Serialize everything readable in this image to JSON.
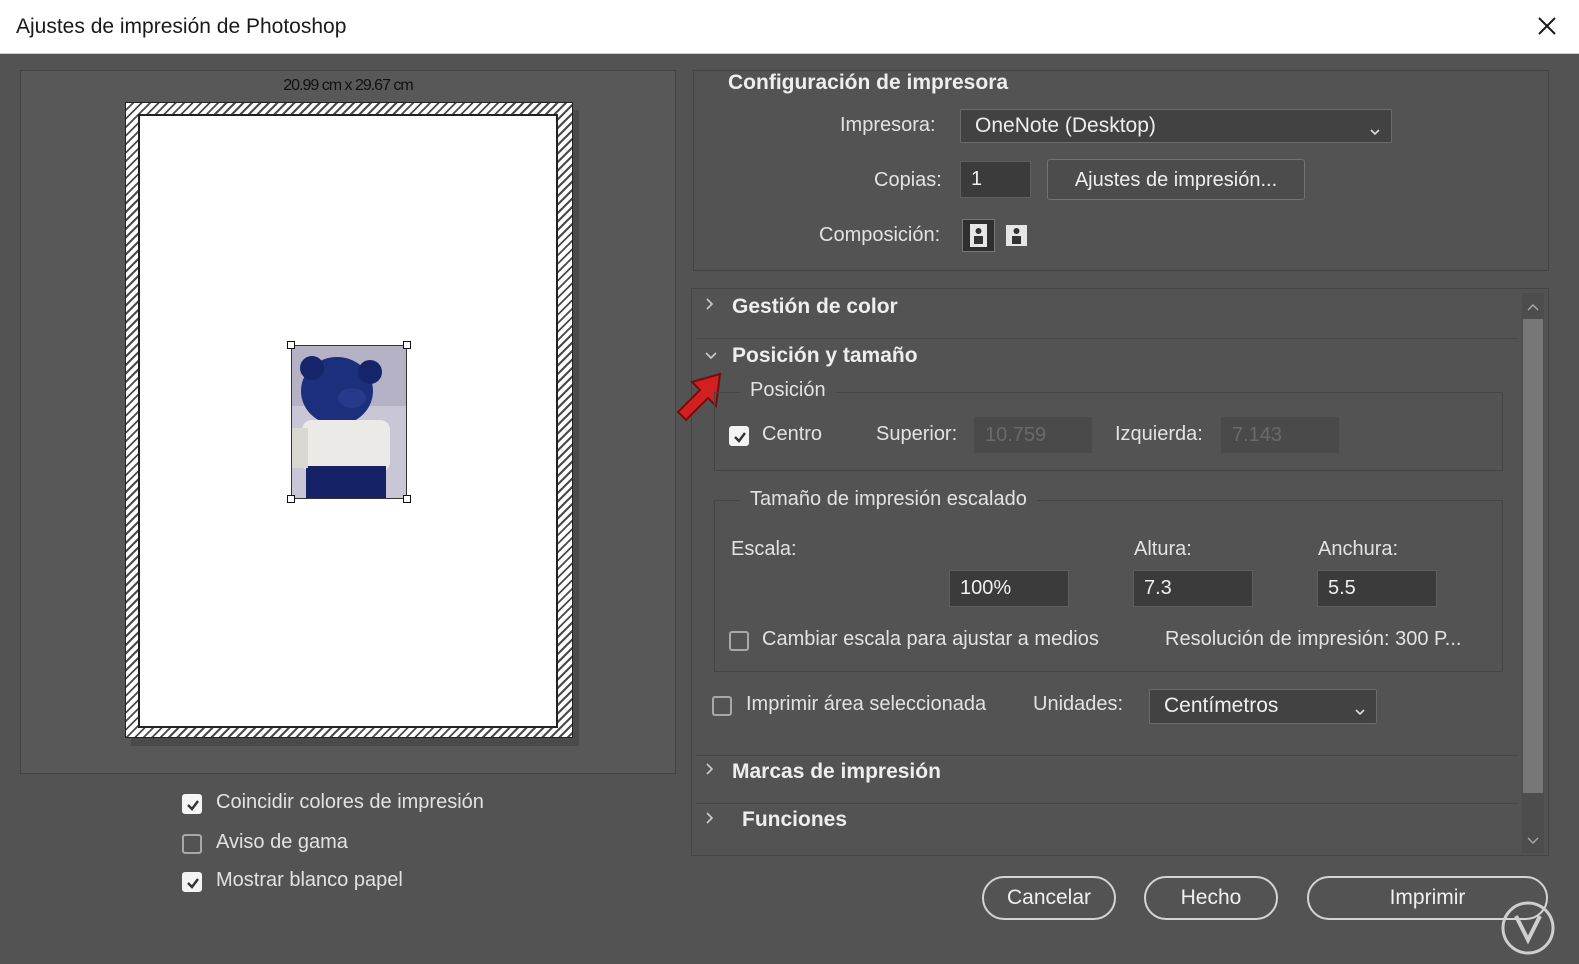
{
  "window": {
    "title": "Ajustes de impresión de Photoshop"
  },
  "preview": {
    "paper_size": "20.99 cm x 29.67 cm"
  },
  "preview_options": [
    {
      "label": "Coincidir colores de impresión",
      "checked": true
    },
    {
      "label": "Aviso de gama",
      "checked": false
    },
    {
      "label": "Mostrar blanco papel",
      "checked": true
    }
  ],
  "printer_setup": {
    "title": "Configuración de impresora",
    "printer_label": "Impresora:",
    "printer_value": "OneNote (Desktop)",
    "copies_label": "Copias:",
    "copies_value": "1",
    "print_settings_button": "Ajustes de impresión...",
    "layout_label": "Composición:"
  },
  "sections": {
    "color_management": "Gestión de color",
    "position_size": "Posición y tamaño",
    "print_marks": "Marcas de impresión",
    "functions": "Funciones"
  },
  "position": {
    "group_title": "Posición",
    "center_label": "Centro",
    "center_checked": true,
    "top_label": "Superior:",
    "top_value": "10.759",
    "left_label": "Izquierda:",
    "left_value": "7.143"
  },
  "scaled": {
    "group_title": "Tamaño de impresión escalado",
    "scale_label": "Escala:",
    "height_label": "Altura:",
    "width_label": "Anchura:",
    "scale_value": "100%",
    "height_value": "7.3",
    "width_value": "5.5",
    "fit_label": "Cambiar escala para ajustar a medios",
    "fit_checked": false,
    "resolution_text": "Resolución de impresión: 300 P..."
  },
  "print_selected": {
    "label": "Imprimir área seleccionada",
    "checked": false
  },
  "units": {
    "label": "Unidades:",
    "value": "Centímetros"
  },
  "buttons": {
    "cancel": "Cancelar",
    "done": "Hecho",
    "print": "Imprimir"
  }
}
